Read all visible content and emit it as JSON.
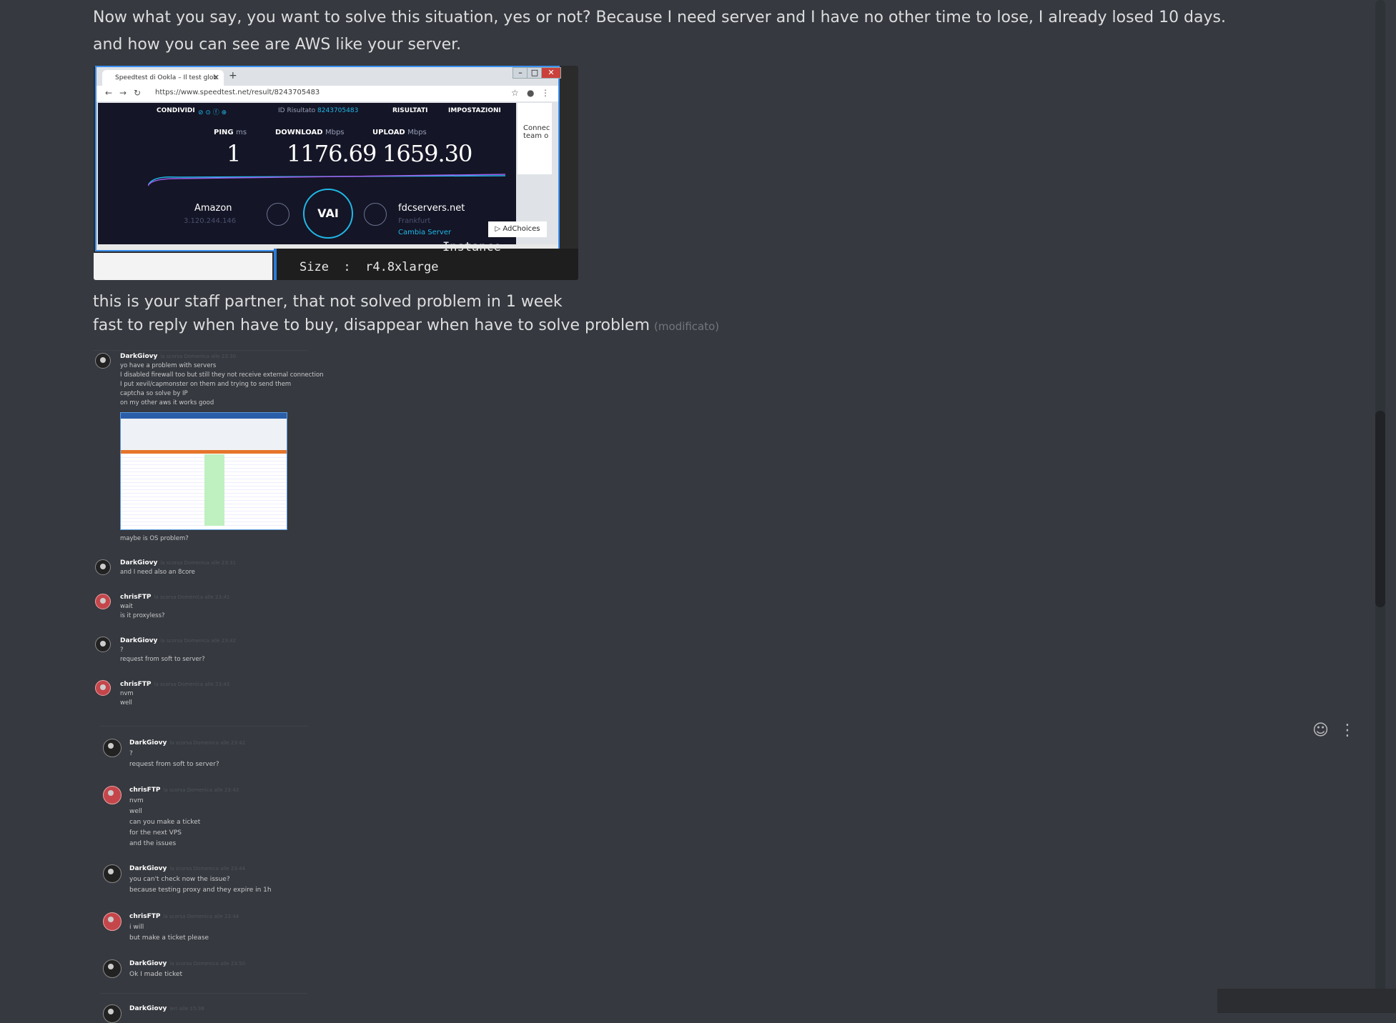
{
  "message": {
    "line1": "Now what you say, you want to solve this situation, yes or not? Because I need server and I have no other time to lose, I already losed 10 days.",
    "line2": "and how you can see are AWS like your server.",
    "line3": "this is your staff partner, that not solved problem in 1 week",
    "line4": "fast to reply when have to buy, disappear when have to solve problem",
    "edited_label": "(modificato)"
  },
  "speedtest": {
    "tab_title": "Speedtest di Ookla – Il test glob",
    "url": "https://www.speedtest.net/result/8243705483",
    "share_label": "CONDIVIDI",
    "result_id_label": "ID Risultato",
    "result_id": "8243705483",
    "results_label": "RISULTATI",
    "settings_label": "IMPOSTAZIONI",
    "ping_label": "PING",
    "ping_unit": "ms",
    "ping": "1",
    "download_label": "DOWNLOAD",
    "download_unit": "Mbps",
    "download": "1176.69",
    "upload_label": "UPLOAD",
    "upload_unit": "Mbps",
    "upload": "1659.30",
    "go_label": "VAI",
    "isp": "Amazon",
    "isp_ip": "3.120.244.146",
    "server": "fdcservers.net",
    "server_city": "Frankfurt",
    "change_server": "Cambia Server",
    "adchoices": "AdChoices",
    "side_ad_line1": "Connec",
    "side_ad_line2": "team o",
    "terminal_top": "Instance",
    "terminal_size": "Size  :  r4.8xlarge"
  },
  "chat_log": [
    {
      "user": "DarkGiovy",
      "time": "la scorsa Domenica alle 23:30",
      "avatar": "dark",
      "lines": [
        "yo have a problem with servers",
        "I disabled firewall too but still they not receive external connection",
        "I put xevil/capmonster on them and trying to send them",
        "captcha so solve by IP",
        "on my other aws it works good"
      ],
      "after_image": "maybe is OS problem?"
    },
    {
      "user": "DarkGiovy",
      "time": "la scorsa Domenica alle 23:31",
      "avatar": "dark",
      "lines": [
        "and I need also an 8core"
      ]
    },
    {
      "user": "chrisFTP",
      "time": "la scorsa Domenica alle 23:41",
      "avatar": "red",
      "lines": [
        "wait",
        "is it proxyless?"
      ]
    },
    {
      "user": "DarkGiovy",
      "time": "la scorsa Domenica alle 23:42",
      "avatar": "dark",
      "lines": [
        "?",
        "request from soft to server?"
      ]
    },
    {
      "user": "chrisFTP",
      "time": "la scorsa Domenica alle 23:43",
      "avatar": "red",
      "lines": [
        "nvm",
        "well"
      ]
    },
    {
      "user": "DarkGiovy",
      "time": "la scorsa Domenica alle 23:42",
      "avatar": "dark",
      "lines": [
        "?",
        "request from soft to server?"
      ]
    },
    {
      "user": "chrisFTP",
      "time": "la scorsa Domenica alle 23:43",
      "avatar": "red",
      "lines": [
        "nvm",
        "well",
        "can you make a ticket",
        "for the next VPS",
        "and the issues"
      ]
    },
    {
      "user": "DarkGiovy",
      "time": "la scorsa Domenica alle 23:44",
      "avatar": "dark",
      "lines": [
        "you can't check now the issue?",
        "because testing proxy and they expire in 1h"
      ]
    },
    {
      "user": "chrisFTP",
      "time": "la scorsa Domenica alle 23:44",
      "avatar": "red",
      "lines": [
        "i will",
        "but make a ticket please"
      ]
    },
    {
      "user": "DarkGiovy",
      "time": "la scorsa Domenica alle 23:50",
      "avatar": "dark",
      "lines": [
        "Ok I made ticket"
      ]
    },
    {
      "user": "DarkGiovy",
      "time": "Ieri alle 15:38",
      "avatar": "dark",
      "lines": []
    }
  ],
  "icons": {
    "add_reaction": "add-reaction-icon",
    "more": "more-options-icon"
  }
}
